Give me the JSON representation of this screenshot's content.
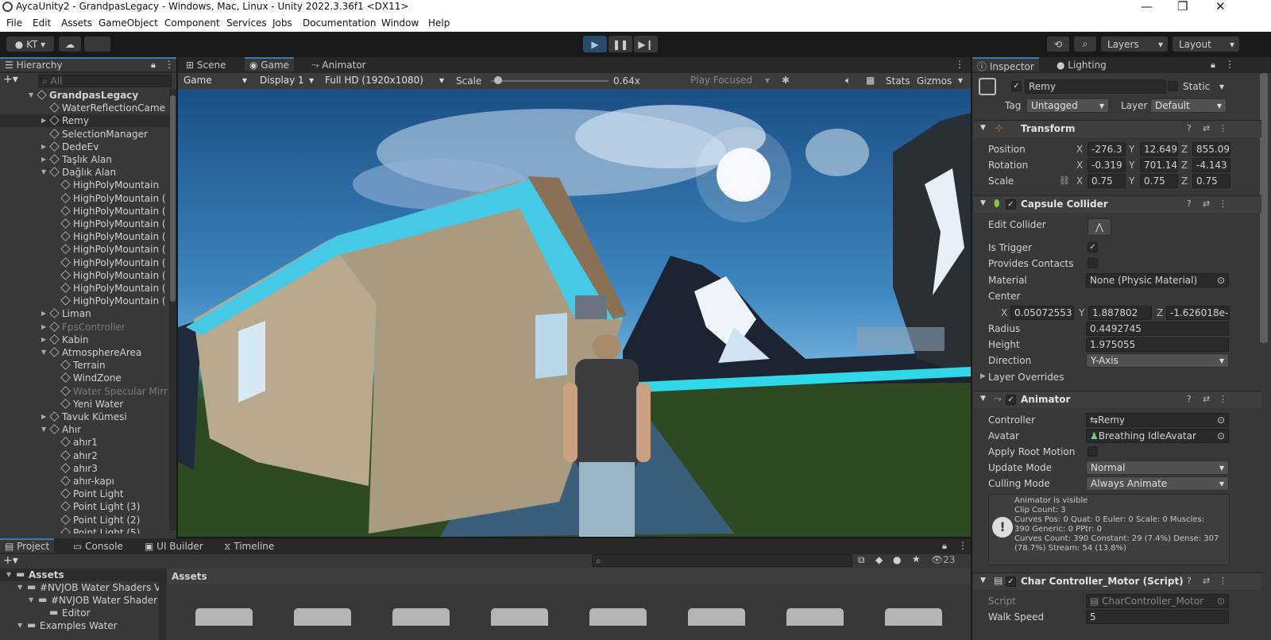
{
  "window": {
    "title": "AycaUnity2 - GrandpasLegacy - Windows, Mac, Linux - Unity 2022.3.36f1 <DX11>",
    "minimize": "—",
    "maximize": "❐",
    "close": "✕"
  },
  "menu": [
    "File",
    "Edit",
    "Assets",
    "GameObject",
    "Component",
    "Services",
    "Jobs",
    "Documentation",
    "Window",
    "Help"
  ],
  "toolbar": {
    "account": "KT",
    "cloud_icon": "cloud-icon",
    "play_icon": "play-icon",
    "pause_icon": "pause-icon",
    "step_icon": "step-icon",
    "layers": "Layers",
    "layout": "Layout"
  },
  "hierarchy": {
    "title": "Hierarchy",
    "search_placeholder": "All",
    "items": [
      {
        "label": "GrandpasLegacy",
        "level": 0,
        "expanded": true,
        "root": true
      },
      {
        "label": "WaterReflectionCame",
        "level": 1
      },
      {
        "label": "Remy",
        "level": 1,
        "collapsed": true,
        "selected": true
      },
      {
        "label": "SelectionManager",
        "level": 1
      },
      {
        "label": "DedeEv",
        "level": 1,
        "collapsed": true
      },
      {
        "label": "Taşlık Alan",
        "level": 1,
        "collapsed": true
      },
      {
        "label": "Dağlık Alan",
        "level": 1,
        "expanded": true
      },
      {
        "label": "HighPolyMountain",
        "level": 2
      },
      {
        "label": "HighPolyMountain (",
        "level": 2
      },
      {
        "label": "HighPolyMountain (",
        "level": 2
      },
      {
        "label": "HighPolyMountain (",
        "level": 2
      },
      {
        "label": "HighPolyMountain (",
        "level": 2
      },
      {
        "label": "HighPolyMountain (",
        "level": 2
      },
      {
        "label": "HighPolyMountain (",
        "level": 2
      },
      {
        "label": "HighPolyMountain (",
        "level": 2
      },
      {
        "label": "HighPolyMountain (",
        "level": 2
      },
      {
        "label": "HighPolyMountain (",
        "level": 2
      },
      {
        "label": "Liman",
        "level": 1,
        "collapsed": true
      },
      {
        "label": "FpsController",
        "level": 1,
        "collapsed": true,
        "dim": true
      },
      {
        "label": "Kabin",
        "level": 1,
        "collapsed": true
      },
      {
        "label": "AtmosphereArea",
        "level": 1,
        "expanded": true
      },
      {
        "label": "Terrain",
        "level": 2
      },
      {
        "label": "WindZone",
        "level": 2
      },
      {
        "label": "Water Specular Mirr",
        "level": 2,
        "dim": true
      },
      {
        "label": "Yeni Water",
        "level": 2
      },
      {
        "label": "Tavuk Kümesi",
        "level": 1,
        "collapsed": true
      },
      {
        "label": "Ahır",
        "level": 1,
        "expanded": true
      },
      {
        "label": "ahır1",
        "level": 2
      },
      {
        "label": "ahır2",
        "level": 2
      },
      {
        "label": "ahır3",
        "level": 2
      },
      {
        "label": "ahır-kapı",
        "level": 2
      },
      {
        "label": "Point Light",
        "level": 2
      },
      {
        "label": "Point Light (3)",
        "level": 2
      },
      {
        "label": "Point Light (2)",
        "level": 2
      },
      {
        "label": "Point Light (5)",
        "level": 2
      }
    ]
  },
  "game_tabs": [
    "Scene",
    "Game",
    "Animator"
  ],
  "game_toolbar": {
    "view": "Game",
    "display": "Display 1",
    "resolution": "Full HD (1920x1080)",
    "scale_label": "Scale",
    "scale_value": "0.64x",
    "scale_fraction": 0.64,
    "play_focused": "Play Focused",
    "stats": "Stats",
    "gizmos": "Gizmos"
  },
  "bottom_tabs": [
    "Project",
    "Console",
    "UI Builder",
    "Timeline"
  ],
  "project": {
    "tree": [
      {
        "label": "Assets",
        "level": 0
      },
      {
        "label": "#NVJOB Water Shaders V",
        "level": 1
      },
      {
        "label": "#NVJOB Water Shader",
        "level": 2
      },
      {
        "label": "Editor",
        "level": 3
      },
      {
        "label": "Examples Water",
        "level": 1
      }
    ],
    "breadcrumb": "Assets",
    "hidden_count": "23"
  },
  "inspector": {
    "tabs": [
      "Inspector",
      "Lighting"
    ],
    "object_name": "Remy",
    "static_label": "Static",
    "tag_label": "Tag",
    "tag_value": "Untagged",
    "layer_label": "Layer",
    "layer_value": "Default",
    "transform": {
      "title": "Transform",
      "position_label": "Position",
      "rotation_label": "Rotation",
      "scale_label": "Scale",
      "position": [
        "-276.3",
        "12.649",
        "855.09"
      ],
      "rotation": [
        "-0.319",
        "701.14",
        "-4.143"
      ],
      "scale": [
        "0.75",
        "0.75",
        "0.75"
      ]
    },
    "capsule": {
      "title": "Capsule Collider",
      "edit_collider": "Edit Collider",
      "is_trigger": "Is Trigger",
      "provides_contacts": "Provides Contacts",
      "material_label": "Material",
      "material_value": "None (Physic Material)",
      "center_label": "Center",
      "center": [
        "0.05072553",
        "1.887802",
        "-1.626018e-"
      ],
      "radius_label": "Radius",
      "radius": "0.4492745",
      "height_label": "Height",
      "height": "1.975055",
      "direction_label": "Direction",
      "direction": "Y-Axis",
      "layer_overrides": "Layer Overrides"
    },
    "animator": {
      "title": "Animator",
      "controller_label": "Controller",
      "controller": "Remy",
      "avatar_label": "Avatar",
      "avatar": "Breathing IdleAvatar",
      "apply_root_label": "Apply Root Motion",
      "update_label": "Update Mode",
      "update_mode": "Normal",
      "culling_label": "Culling Mode",
      "culling_mode": "Always Animate",
      "info": [
        "Animator is visible",
        "Clip Count: 3",
        "Curves Pos: 0 Quat: 0 Euler: 0 Scale: 0 Muscles:",
        "390 Generic: 0 PPtr: 0",
        "Curves Count: 390 Constant: 29 (7.4%) Dense: 307",
        "(78.7%) Stream: 54 (13.8%)"
      ]
    },
    "script": {
      "title": "Char Controller_Motor (Script)",
      "script_label": "Script",
      "script_value": "CharController_Motor",
      "walk_label": "Walk Speed",
      "walk_value": "5"
    }
  },
  "colors": {
    "accent": "#3a79bb",
    "panel": "#383838",
    "dark": "#191919",
    "sky": "#2e6fa8"
  }
}
